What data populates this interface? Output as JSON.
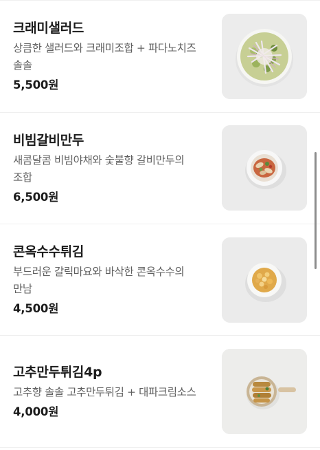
{
  "menu": {
    "items": [
      {
        "name": "크래미샐러드",
        "desc_lines": [
          "상큼한 샐러드와 크래미조합 + 파다노치즈",
          "솔솔"
        ],
        "price": "5,500원",
        "image": "crab-salad-photo"
      },
      {
        "name": "비빔갈비만두",
        "desc_lines": [
          "새콤달콤 비빔야채와 숯불향 갈비만두의",
          "조합"
        ],
        "price": "6,500원",
        "image": "bibim-galbi-mandu-photo"
      },
      {
        "name": "콘옥수수튀김",
        "desc_lines": [
          "부드러운 갈릭마요와 바삭한 콘옥수수의",
          "만남"
        ],
        "price": "4,500원",
        "image": "corn-fritter-photo"
      },
      {
        "name": "고추만두튀김4p",
        "desc_lines": [
          "고추향 솔솔 고추만두튀김 + 대파크림소스"
        ],
        "price": "4,000원",
        "image": "pepper-dumpling-fry-photo"
      }
    ]
  }
}
